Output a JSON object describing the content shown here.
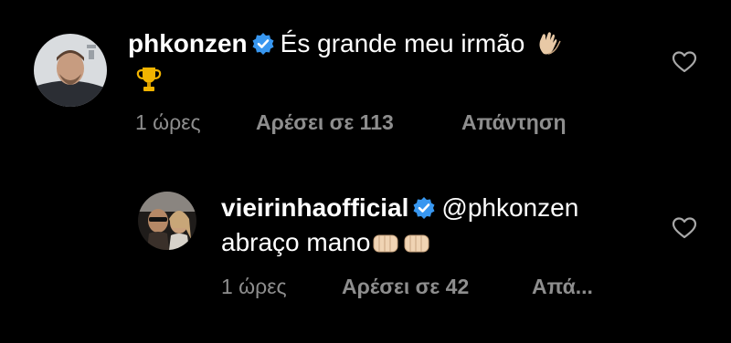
{
  "comments": [
    {
      "username": "phkonzen",
      "verified": true,
      "text": "És grande meu irmão",
      "emoji_line2": "trophy",
      "time": "1 ώρες",
      "likes": "Αρέσει σε 113",
      "reply": "Απάντηση"
    },
    {
      "username": "vieirinhaofficial",
      "verified": true,
      "mention": "@phkonzen",
      "text": "abraço mano",
      "time": "1 ώρες",
      "likes": "Αρέσει σε 42",
      "reply": "Απά..."
    }
  ],
  "colors": {
    "background": "#000000",
    "text": "#ffffff",
    "meta": "#8e8e8e",
    "verified_badge": "#3897f0",
    "heart": "#a8a8a8"
  },
  "icons": [
    "verified-badge-icon",
    "clapping-hands-icon",
    "trophy-icon",
    "fist-bump-icon",
    "heart-icon"
  ]
}
